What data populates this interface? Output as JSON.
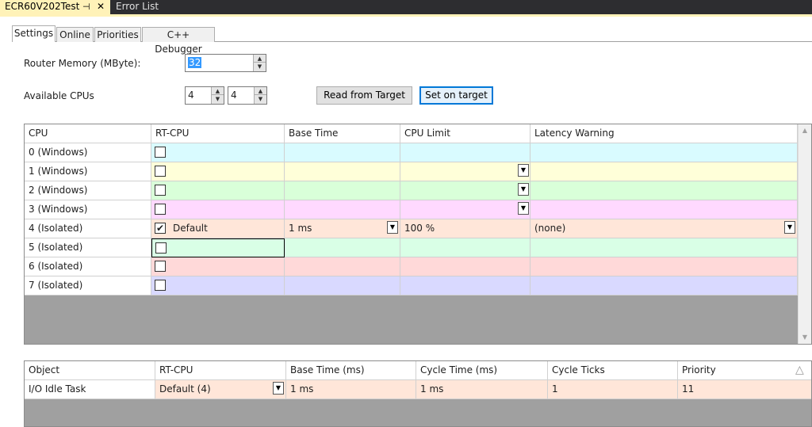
{
  "doc_tabs": {
    "active": "ECR60V202Test",
    "pin": "⊣",
    "close": "✕",
    "inactive": "Error List"
  },
  "inner_tabs": [
    "Settings",
    "Online",
    "Priorities",
    "C++ Debugger"
  ],
  "router_memory": {
    "label": "Router Memory (MByte):",
    "value": "32"
  },
  "available_cpus": {
    "label": "Available CPUs",
    "value1": "4",
    "value2": "4"
  },
  "buttons": {
    "read": "Read from Target",
    "set": "Set on target"
  },
  "cpu_grid": {
    "headers": [
      "CPU",
      "RT-CPU",
      "Base Time",
      "CPU Limit",
      "Latency Warning"
    ],
    "rows": [
      {
        "cpu": "0 (Windows)",
        "checked": false,
        "rt_label": "",
        "base_time": "",
        "cpu_limit": "",
        "latency": "",
        "color": "#d9fbff",
        "dd_limit": false,
        "dd_base": false,
        "dd_latency": false
      },
      {
        "cpu": "1 (Windows)",
        "checked": false,
        "rt_label": "",
        "base_time": "",
        "cpu_limit": "",
        "latency": "",
        "color": "#ffffd9",
        "dd_limit": true,
        "dd_base": false,
        "dd_latency": false
      },
      {
        "cpu": "2 (Windows)",
        "checked": false,
        "rt_label": "",
        "base_time": "",
        "cpu_limit": "",
        "latency": "",
        "color": "#d9ffd9",
        "dd_limit": true,
        "dd_base": false,
        "dd_latency": false
      },
      {
        "cpu": "3 (Windows)",
        "checked": false,
        "rt_label": "",
        "base_time": "",
        "cpu_limit": "",
        "latency": "",
        "color": "#ffd9ff",
        "dd_limit": true,
        "dd_base": false,
        "dd_latency": false
      },
      {
        "cpu": "4 (Isolated)",
        "checked": true,
        "rt_label": "Default",
        "base_time": "1 ms",
        "cpu_limit": "100 %",
        "latency": "(none)",
        "color": "#ffe6d9",
        "dd_limit": false,
        "dd_base": true,
        "dd_latency": true
      },
      {
        "cpu": "5 (Isolated)",
        "checked": false,
        "rt_label": "",
        "base_time": "",
        "cpu_limit": "",
        "latency": "",
        "color": "#d9ffe6",
        "dd_limit": false,
        "dd_base": false,
        "dd_latency": false
      },
      {
        "cpu": "6 (Isolated)",
        "checked": false,
        "rt_label": "",
        "base_time": "",
        "cpu_limit": "",
        "latency": "",
        "color": "#ffd9d9",
        "dd_limit": false,
        "dd_base": false,
        "dd_latency": false
      },
      {
        "cpu": "7 (Isolated)",
        "checked": false,
        "rt_label": "",
        "base_time": "",
        "cpu_limit": "",
        "latency": "",
        "color": "#d9d9ff",
        "dd_limit": false,
        "dd_base": false,
        "dd_latency": false
      }
    ]
  },
  "task_grid": {
    "headers": [
      "Object",
      "RT-CPU",
      "Base Time (ms)",
      "Cycle Time (ms)",
      "Cycle Ticks",
      "Priority"
    ],
    "sort_icon": "△",
    "rows": [
      {
        "object": "I/O Idle Task",
        "rt_cpu": "Default (4)",
        "base_time": "1 ms",
        "cycle_time": "1 ms",
        "cycle_ticks": "1",
        "priority": "11",
        "color": "#ffe6d9"
      }
    ]
  },
  "glyphs": {
    "check": "✔",
    "dropdown": "▼",
    "up": "▲",
    "down": "▼"
  }
}
